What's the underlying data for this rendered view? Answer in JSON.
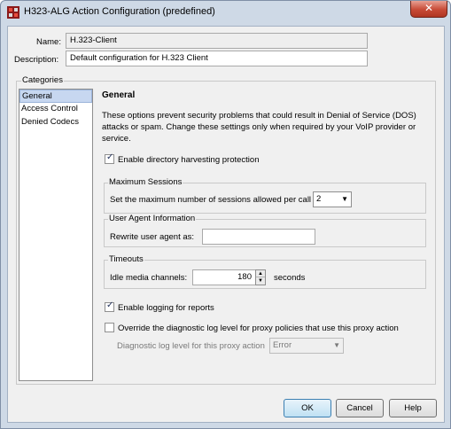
{
  "window": {
    "title": "H323-ALG Action Configuration (predefined)",
    "close_glyph": "✕"
  },
  "form": {
    "name_label": "Name:",
    "name_value": "H.323-Client",
    "description_label": "Description:",
    "description_value": "Default configuration for H.323 Client"
  },
  "categories": {
    "legend": "Categories",
    "items": [
      "General",
      "Access Control",
      "Denied Codecs"
    ],
    "selected": "General"
  },
  "general": {
    "title": "General",
    "description": "These options prevent security problems that could result in Denial of Service (DOS) attacks or spam. Change these settings only when required by your VoIP provider or service.",
    "directory_harvesting_label": "Enable directory harvesting protection",
    "directory_harvesting_checked": true,
    "max_sessions": {
      "legend": "Maximum Sessions",
      "label": "Set the maximum number of sessions allowed per call",
      "value": "2"
    },
    "user_agent": {
      "legend": "User Agent Information",
      "label": "Rewrite user agent as:",
      "value": ""
    },
    "timeouts": {
      "legend": "Timeouts",
      "label": "Idle media channels:",
      "value": "180",
      "unit": "seconds"
    },
    "logging_label": "Enable logging for reports",
    "logging_checked": true,
    "override_label": "Override the diagnostic log level for proxy policies that use this proxy action",
    "override_checked": false,
    "diag_label": "Diagnostic log level for this proxy action",
    "diag_value": "Error"
  },
  "buttons": {
    "ok": "OK",
    "cancel": "Cancel",
    "help": "Help"
  },
  "icons": {
    "app": "firewall-app-icon",
    "check": "✓",
    "arrow_down": "▼",
    "arrow_up": "▲"
  }
}
